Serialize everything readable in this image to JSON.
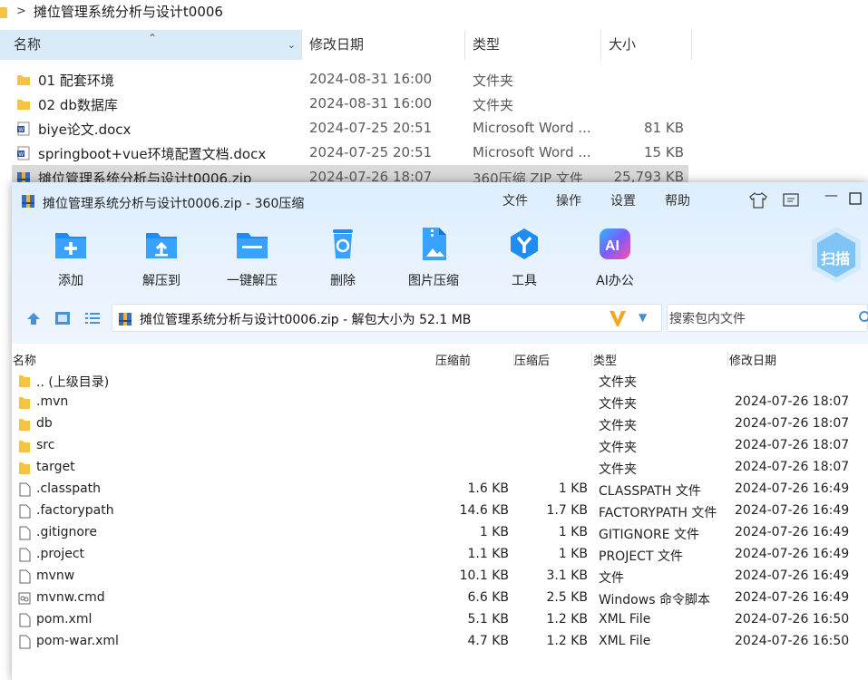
{
  "explorer": {
    "breadcrumb": "摊位管理系统分析与设计t0006",
    "columns": {
      "name": "名称",
      "date": "修改日期",
      "type": "类型",
      "size": "大小"
    },
    "rows": [
      {
        "name": "01 配套环境",
        "date": "2024-08-31 16:00",
        "type": "文件夹",
        "size": "",
        "icon": "folder-icon"
      },
      {
        "name": "02 db数据库",
        "date": "2024-08-31 16:00",
        "type": "文件夹",
        "size": "",
        "icon": "folder-icon"
      },
      {
        "name": "biye论文.docx",
        "date": "2024-07-25 20:51",
        "type": "Microsoft Word ...",
        "size": "81 KB",
        "icon": "word-doc-icon"
      },
      {
        "name": "springboot+vue环境配置文档.docx",
        "date": "2024-07-25 20:51",
        "type": "Microsoft Word ...",
        "size": "15 KB",
        "icon": "word-doc-icon"
      },
      {
        "name": "摊位管理系统分析与设计t0006.zip",
        "date": "2024-07-26 18:07",
        "type": "360压缩 ZIP 文件",
        "size": "25,793 KB",
        "icon": "zip-archive-icon"
      }
    ]
  },
  "zip": {
    "window_title": "摊位管理系统分析与设计t0006.zip - 360压缩",
    "menu": [
      "文件",
      "操作",
      "设置",
      "帮助"
    ],
    "toolbar": [
      {
        "label": "添加",
        "icon": "add-icon"
      },
      {
        "label": "解压到",
        "icon": "extract-to-icon"
      },
      {
        "label": "一键解压",
        "icon": "one-click-extract-icon"
      },
      {
        "label": "删除",
        "icon": "delete-icon"
      },
      {
        "label": "图片压缩",
        "icon": "image-compress-icon"
      },
      {
        "label": "工具",
        "icon": "tools-icon"
      },
      {
        "label": "AI办公",
        "icon": "ai-office-icon"
      }
    ],
    "scan_label": "扫描",
    "path": "摊位管理系统分析与设计t0006.zip - 解包大小为 52.1 MB",
    "search_placeholder": "搜索包内文件",
    "columns": {
      "name": "名称",
      "compressed_before": "压缩前",
      "compressed_after": "压缩后",
      "type": "类型",
      "modified": "修改日期"
    },
    "rows": [
      {
        "name": ".. (上级目录)",
        "before": "",
        "after": "",
        "type": "文件夹",
        "date": "",
        "icon": "folder-icon"
      },
      {
        "name": ".mvn",
        "before": "",
        "after": "",
        "type": "文件夹",
        "date": "2024-07-26 18:07",
        "icon": "folder-icon"
      },
      {
        "name": "db",
        "before": "",
        "after": "",
        "type": "文件夹",
        "date": "2024-07-26 18:07",
        "icon": "folder-icon"
      },
      {
        "name": "src",
        "before": "",
        "after": "",
        "type": "文件夹",
        "date": "2024-07-26 18:07",
        "icon": "folder-icon"
      },
      {
        "name": "target",
        "before": "",
        "after": "",
        "type": "文件夹",
        "date": "2024-07-26 18:07",
        "icon": "folder-icon"
      },
      {
        "name": ".classpath",
        "before": "1.6 KB",
        "after": "1 KB",
        "type": "CLASSPATH 文件",
        "date": "2024-07-26 16:49",
        "icon": "file-icon"
      },
      {
        "name": ".factorypath",
        "before": "14.6 KB",
        "after": "1.7 KB",
        "type": "FACTORYPATH 文件",
        "date": "2024-07-26 16:49",
        "icon": "file-icon"
      },
      {
        "name": ".gitignore",
        "before": "1 KB",
        "after": "1 KB",
        "type": "GITIGNORE 文件",
        "date": "2024-07-26 16:49",
        "icon": "file-icon"
      },
      {
        "name": ".project",
        "before": "1.1 KB",
        "after": "1 KB",
        "type": "PROJECT 文件",
        "date": "2024-07-26 16:49",
        "icon": "file-icon"
      },
      {
        "name": "mvnw",
        "before": "10.1 KB",
        "after": "3.1 KB",
        "type": "文件",
        "date": "2024-07-26 16:49",
        "icon": "file-icon"
      },
      {
        "name": "mvnw.cmd",
        "before": "6.6 KB",
        "after": "2.5 KB",
        "type": "Windows 命令脚本",
        "date": "2024-07-26 16:49",
        "icon": "cmd-script-icon"
      },
      {
        "name": "pom.xml",
        "before": "5.1 KB",
        "after": "1.2 KB",
        "type": "XML File",
        "date": "2024-07-26 16:50",
        "icon": "file-icon"
      },
      {
        "name": "pom-war.xml",
        "before": "4.7 KB",
        "after": "1.2 KB",
        "type": "XML File",
        "date": "2024-07-26 16:50",
        "icon": "file-icon"
      }
    ]
  },
  "colors": {
    "accent": "#1e90ff",
    "selected_header": "#d9ebf9",
    "folder": "#f5c242"
  }
}
